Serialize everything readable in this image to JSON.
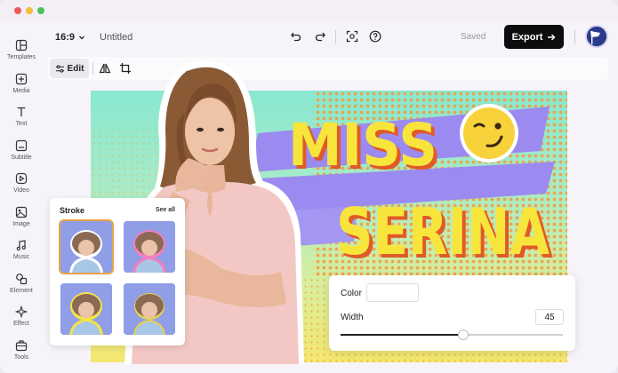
{
  "sidebar": {
    "items": [
      {
        "label": "Templates",
        "icon": "templates-icon"
      },
      {
        "label": "Media",
        "icon": "media-icon"
      },
      {
        "label": "Text",
        "icon": "text-icon"
      },
      {
        "label": "Subtitle",
        "icon": "subtitle-icon"
      },
      {
        "label": "Video",
        "icon": "video-icon"
      },
      {
        "label": "Image",
        "icon": "image-icon"
      },
      {
        "label": "Music",
        "icon": "music-icon"
      },
      {
        "label": "Element",
        "icon": "element-icon"
      },
      {
        "label": "Effect",
        "icon": "effect-icon"
      },
      {
        "label": "Tools",
        "icon": "tools-icon"
      }
    ]
  },
  "topbar": {
    "aspect_ratio": "16:9",
    "title": "Untitled",
    "status": "Saved",
    "export_label": "Export"
  },
  "edit_toolbar": {
    "edit_label": "Edit"
  },
  "canvas": {
    "headline_line1": "MISS",
    "headline_line2": "SERINA"
  },
  "stroke_panel": {
    "title": "Stroke",
    "see_all": "See all",
    "options": [
      {
        "stroke_color": "#ffffff",
        "selected": true
      },
      {
        "stroke_color": "#f27fc0",
        "selected": false
      },
      {
        "stroke_color": "#f3e34a",
        "selected": false
      },
      {
        "stroke_color": "#e6d34e",
        "selected": false
      }
    ]
  },
  "stroke_settings": {
    "color_label": "Color",
    "width_label": "Width",
    "width_value": "45",
    "slider_fraction": 0.55
  },
  "colors": {
    "export_bg": "#0d0d0f",
    "headline_yellow": "#f8e53c",
    "ribbon_purple": "#9b8bf0",
    "halftone_orange": "#f39a3c"
  }
}
